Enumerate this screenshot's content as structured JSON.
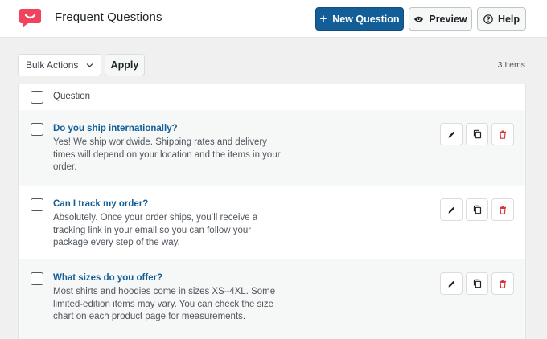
{
  "header": {
    "title": "Frequent Questions",
    "new_label": "New Question",
    "preview_label": "Preview",
    "help_label": "Help"
  },
  "toolbar": {
    "bulk_actions": "Bulk Actions",
    "apply_label": "Apply",
    "item_count": "3 Items"
  },
  "table": {
    "column_header": "Question",
    "rows": [
      {
        "question": "Do you ship internationally?",
        "answer_lines": [
          "Yes! We ship worldwide. Shipping rates and delivery",
          "times will depend on your location and the items in your",
          "order."
        ]
      },
      {
        "question": "Can I track my order?",
        "answer_lines": [
          "Absolutely. Once your order ships, you’ll receive a",
          "tracking link in your email so you can follow your",
          "package every step of the way."
        ]
      },
      {
        "question": "What sizes do you offer?",
        "answer_lines": [
          "Most shirts and hoodies come in sizes XS–4XL. Some",
          "limited-edition items may vary. You can check the size",
          "chart on each product page for measurements."
        ]
      }
    ]
  },
  "colors": {
    "brand_logo": "#f0445d",
    "primary_button": "#135e96",
    "link": "#135e96",
    "delete_icon": "#d63638",
    "row_alt_bg": "#f6f7f7"
  },
  "icons": {
    "logo": "chat-smile-logo",
    "new": "plus-icon",
    "preview": "eye-icon",
    "help": "question-circle-icon",
    "select": "chevron-down-icon",
    "edit": "pencil-icon",
    "duplicate": "copy-icon",
    "delete": "trash-icon"
  }
}
